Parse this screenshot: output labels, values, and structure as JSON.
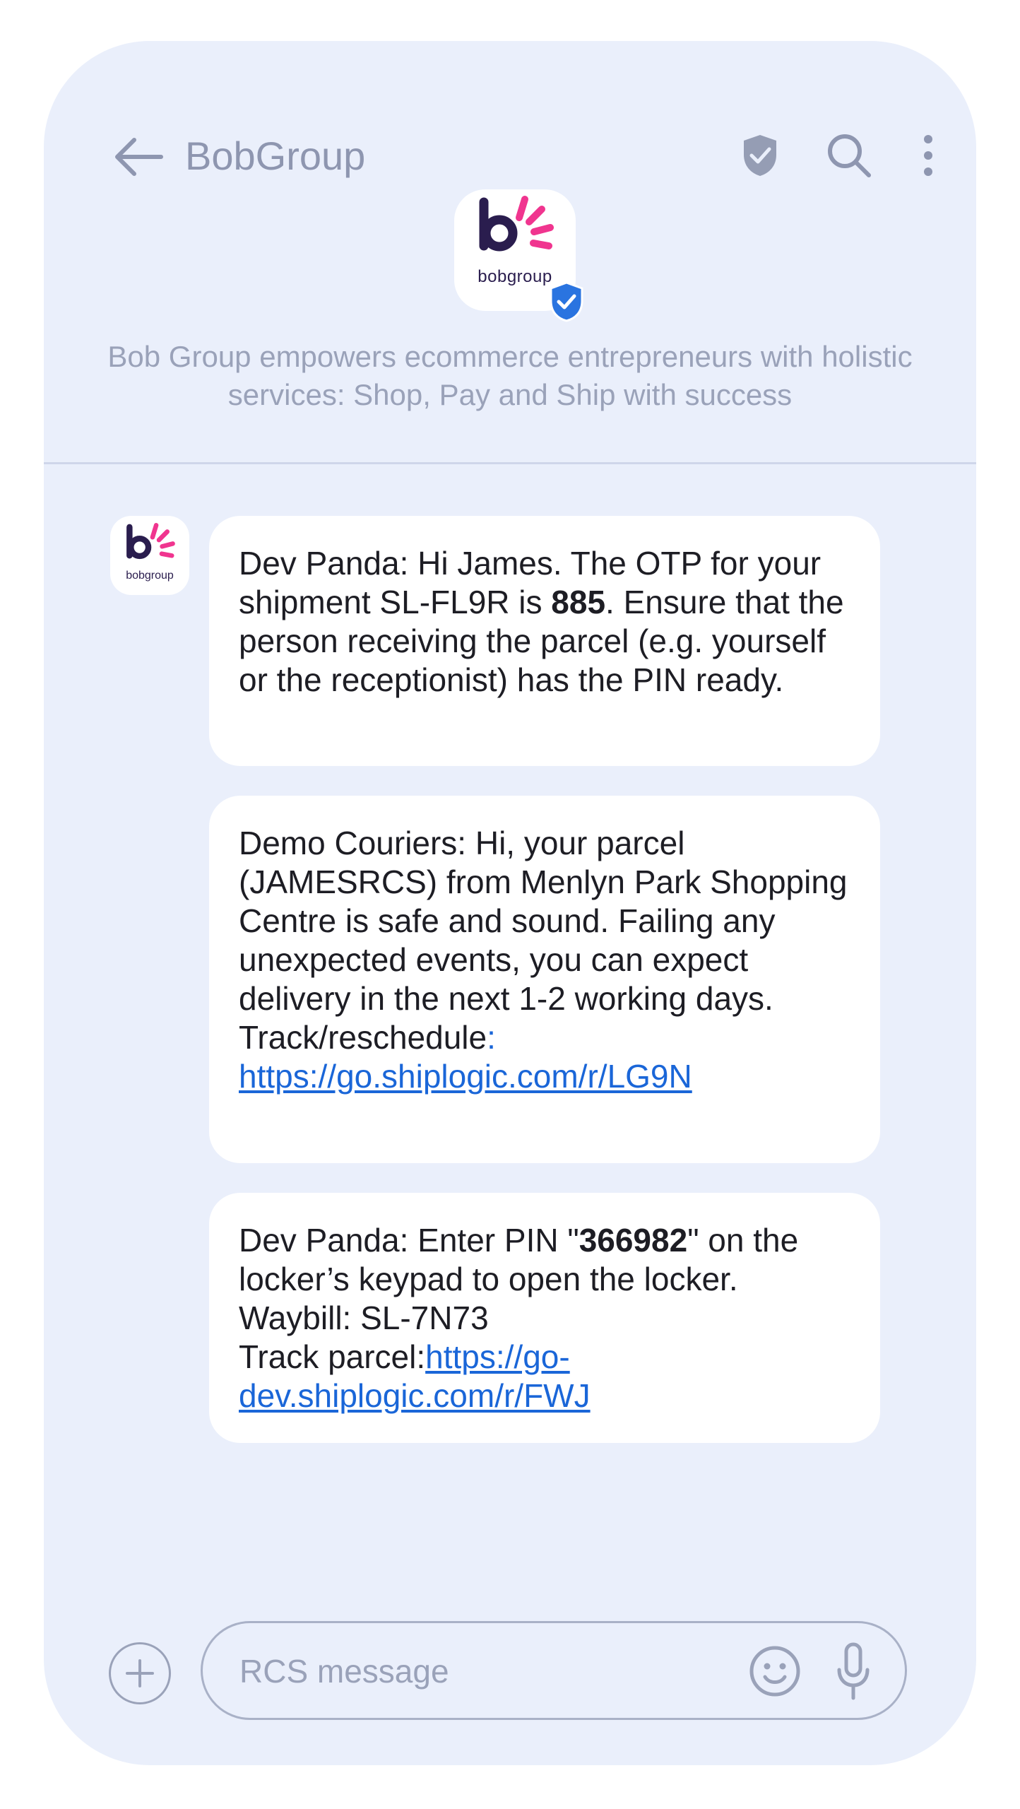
{
  "header": {
    "title": "BobGroup",
    "icons": [
      "back-arrow-icon",
      "verified-shield-icon",
      "search-icon",
      "more-vertical-icon"
    ]
  },
  "profile": {
    "logo_text": "bobgroup",
    "description": "Bob Group empowers ecommerce entrepreneurs with holistic services: Shop, Pay and Ship with success"
  },
  "colors": {
    "background": "#eaeffb",
    "bubble": "#ffffff",
    "link": "#1a66d8",
    "brand_purple": "#2a1d4e",
    "brand_pink": "#f0358f",
    "verified_blue": "#2a74e0",
    "muted": "#9aa2b9"
  },
  "messages": [
    {
      "part1": "Dev Panda: Hi James. The OTP for your shipment SL-FL9R is ",
      "bold": "885",
      "part2": ". Ensure that the person receiving the parcel (e.g. yourself or the receptionist) has the PIN ready."
    },
    {
      "text": "Demo Couriers: Hi, your parcel (JAMESRCS) from Menlyn Park Shopping Centre is safe and sound. Failing any unexpected events, you can expect delivery in the next 1-2 working days.",
      "track_label": "Track/reschedule",
      "track_colon": ":",
      "link": "https://go.shiplogic.com/r/LG9N"
    },
    {
      "part1": "Dev Panda: Enter PIN \"",
      "bold": "366982",
      "part2": "\" on the locker’s keypad to open the locker. Waybill: SL-7N73",
      "track_label": "Track parcel:",
      "link": "https://go-dev.shiplogic.com/r/FWJ"
    }
  ],
  "composer": {
    "placeholder": "RCS message",
    "value": "",
    "icons": [
      "add-icon",
      "emoji-icon",
      "microphone-icon"
    ]
  }
}
